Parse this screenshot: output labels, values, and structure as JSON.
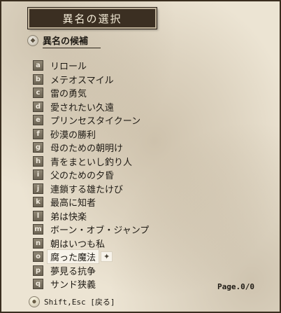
{
  "window": {
    "title": "異名の選択"
  },
  "section": {
    "header": "異名の候補",
    "header_icon": "diamond-icon"
  },
  "items": [
    {
      "key": "a",
      "label": "リロール"
    },
    {
      "key": "b",
      "label": "メテオスマイル"
    },
    {
      "key": "c",
      "label": "雷の勇気"
    },
    {
      "key": "d",
      "label": "愛されたい久遠"
    },
    {
      "key": "e",
      "label": "プリンセスタイクーン"
    },
    {
      "key": "f",
      "label": "砂漠の勝利"
    },
    {
      "key": "g",
      "label": "母のための朝明け"
    },
    {
      "key": "h",
      "label": "青をまといし釣り人"
    },
    {
      "key": "i",
      "label": "父のための夕昏"
    },
    {
      "key": "j",
      "label": "連鎖する雄たけび"
    },
    {
      "key": "k",
      "label": "最高に知者"
    },
    {
      "key": "l",
      "label": "弟は快楽"
    },
    {
      "key": "m",
      "label": "ボーン・オブ・ジャンプ"
    },
    {
      "key": "n",
      "label": "朝はいつも私"
    },
    {
      "key": "o",
      "label": "腐った魔法",
      "selected": true
    },
    {
      "key": "p",
      "label": "夢見る抗争"
    },
    {
      "key": "q",
      "label": "サンド狭義"
    }
  ],
  "cursor_glyph": "✦",
  "page": "Page.0/0",
  "footer": {
    "hint": "Shift,Esc [戻る]",
    "icon": "lightbulb-icon"
  }
}
